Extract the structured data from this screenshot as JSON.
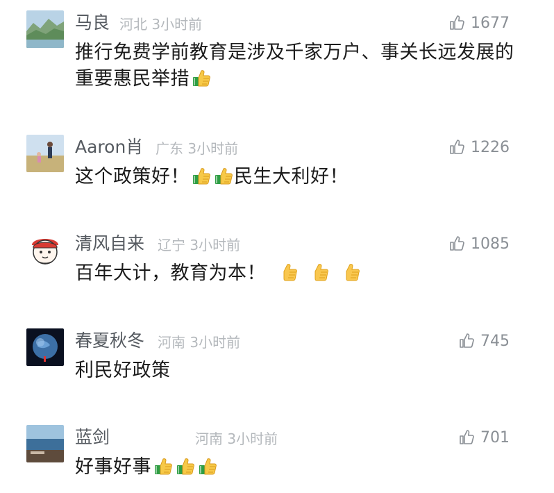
{
  "comments": [
    {
      "name": "马良",
      "meta": "河北 3小时前",
      "likes": "1677",
      "text_lines": [
        "推行免费学前教育是涉及千家万户、事关长远发展的",
        "重要惠民举措"
      ],
      "avatar": "mountain-lake-photo",
      "emojis": [
        "green-thumbs-up"
      ]
    },
    {
      "name": "Aaron肖",
      "meta": "广东 3小时前",
      "likes": "1226",
      "text_parts": [
        "这个政策好！",
        "民生大利好！"
      ],
      "avatar": "person-field-photo",
      "emojis": [
        "green-thumbs-up",
        "green-thumbs-up"
      ]
    },
    {
      "name": "清风自来",
      "meta": "辽宁 3小时前",
      "likes": "1085",
      "text": "百年大计，教育为本！",
      "avatar": "cartoon-mascot",
      "emojis": [
        "yellow-thumbs-up",
        "yellow-thumbs-up",
        "yellow-thumbs-up"
      ]
    },
    {
      "name": "春夏秋冬",
      "meta": "河南 3小时前",
      "likes": "745",
      "text": "利民好政策",
      "avatar": "earth-night-photo"
    },
    {
      "name": "蓝剑",
      "meta": "河南 3小时前",
      "likes": "701",
      "text": "好事好事",
      "avatar": "seascape-photo",
      "emojis": [
        "green-thumbs-up",
        "green-thumbs-up",
        "green-thumbs-up"
      ]
    }
  ]
}
